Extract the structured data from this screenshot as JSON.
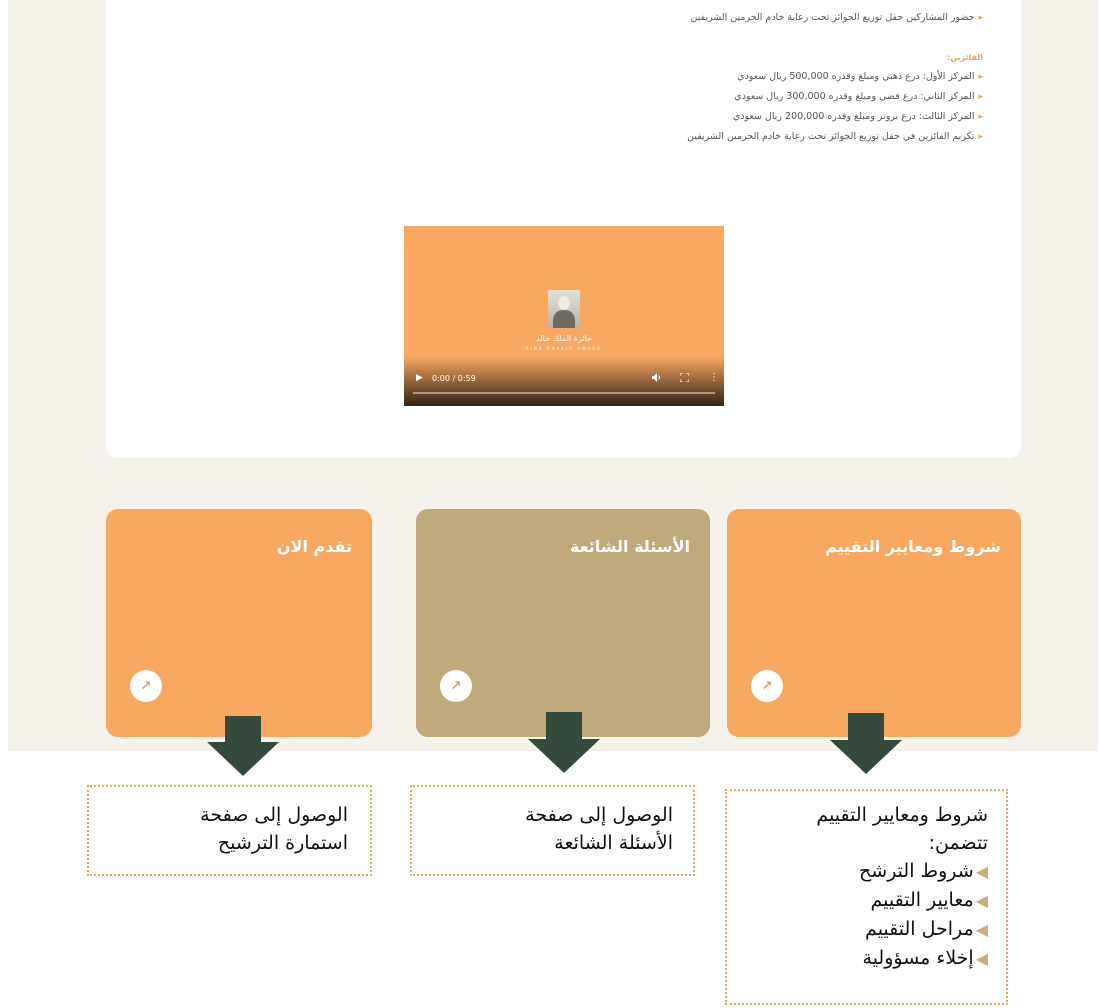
{
  "content": {
    "top_bullet": "حضور المشاركين حفل توزيع الجوائز تحت رعاية خادم الحرمين الشريفين",
    "winners_heading": "الفائزين:",
    "winners": [
      "المركز الأول: درع ذهبي ومبلغ وقدره 500,000 ريال سعودي",
      "المركز الثاني: درع فضي ومبلغ وقدره 300,000 ريال سعودي",
      "المركز الثالث: درع برونز ومبلغ وقدره 200,000 ريال سعودي",
      "تكريم الفائزين في حفل توزيع الجوائز تحت رعاية خادم الحرمين الشريفين"
    ]
  },
  "video": {
    "brand_ar": "جائزة الملك خالد",
    "brand_en": "KING KHALID AWARD",
    "time": "0:00 / 0:59",
    "progress": 0.0
  },
  "cards": [
    {
      "title": "شروط ومعايير التقييم",
      "color": "#f9a862"
    },
    {
      "title": "الأسئلة الشائعة",
      "color": "#c0a97a"
    },
    {
      "title": "تقدم الان",
      "color": "#f9a862"
    }
  ],
  "annotations": {
    "arrow_color": "#334a3c",
    "criteria": {
      "line1": "شروط ومعايير التقييم",
      "line2": "تتضمن:",
      "items": [
        "شروط الترشح",
        "معايير التقييم",
        "مراحل التقييم",
        "إخلاء مسؤولية"
      ]
    },
    "faq": {
      "line1": "الوصول إلى صفحة",
      "line2": "الأسئلة الشائعة"
    },
    "apply": {
      "line1": "الوصول إلى صفحة",
      "line2": "استمارة الترشيح"
    }
  }
}
